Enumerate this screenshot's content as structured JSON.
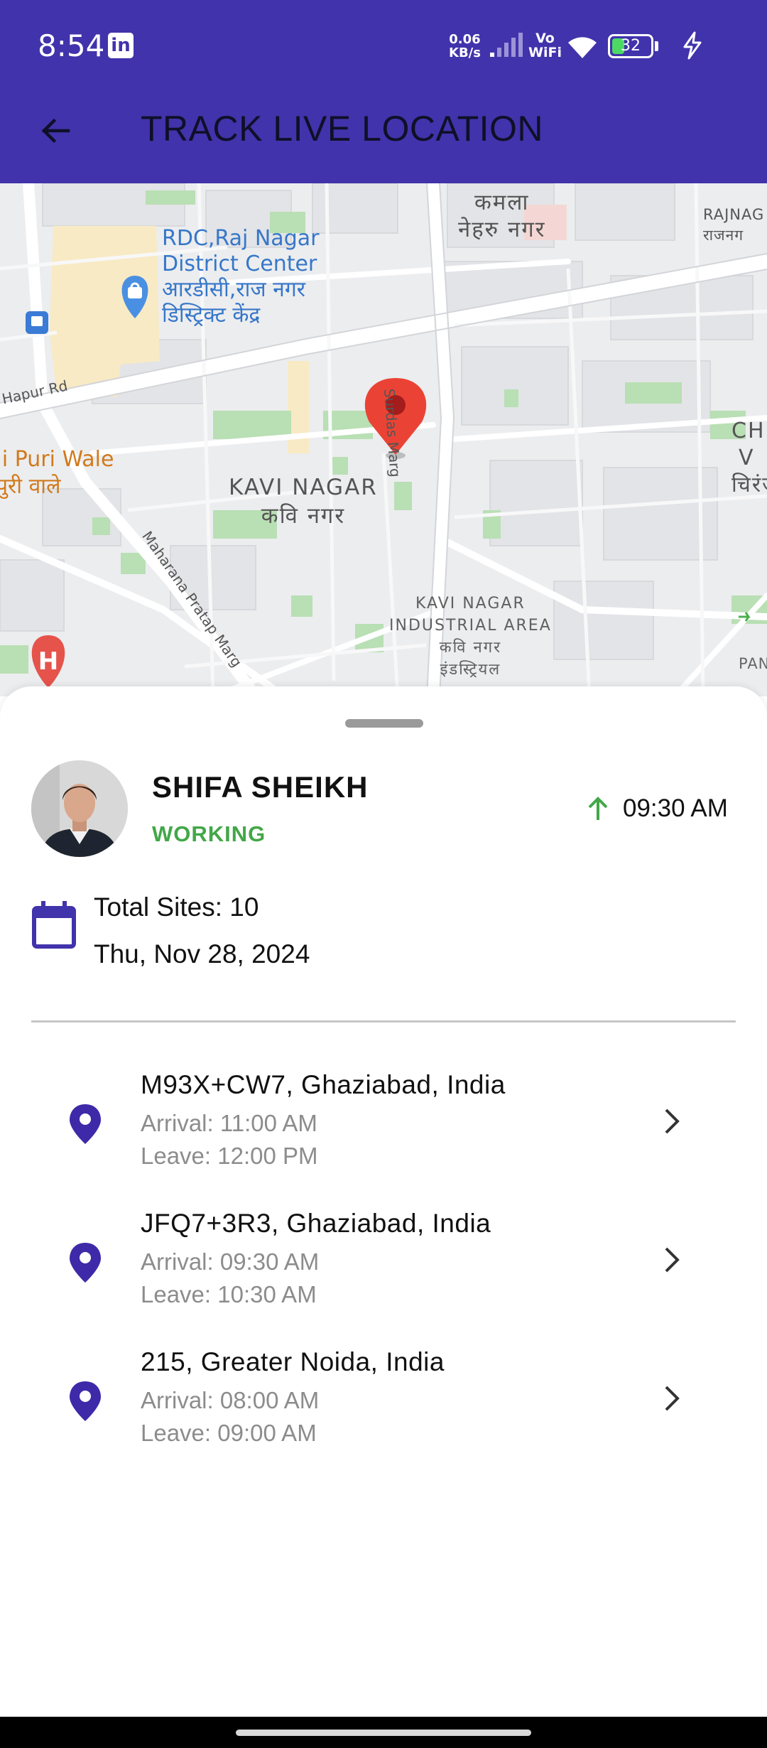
{
  "status_bar": {
    "time": "8:54",
    "app_notification_icon": "linkedin-icon",
    "net_speed_value": "0.06",
    "net_speed_unit": "KB/s",
    "vowifi_top": "Vo",
    "vowifi_bottom": "WiFi",
    "battery_level": "32",
    "battery_fraction": 0.32,
    "charging": true
  },
  "header": {
    "title": "TRACK LIVE LOCATION",
    "back_icon": "arrow-left-icon",
    "background_color": "#4133AB"
  },
  "map": {
    "labels": {
      "kamla_nehru_nagar_hi_1": "कमला",
      "kamla_nehru_nagar_hi_2": "नेहरु नगर",
      "rajnagar_en": "RAJNAG",
      "rajnagar_hi": "राजनग",
      "rdc_en_1": "RDC,Raj Nagar",
      "rdc_en_2": "District Center",
      "rdc_hi_1": "आरडीसी,राज नगर",
      "rdc_hi_2": "डिस्ट्रिक्ट केंद्र",
      "hapur_rd": "Hapur Rd",
      "surdas_marg": "Surdas Marg",
      "ji_puri_wale_en": "Ji Puri Wale",
      "ji_puri_wale_hi": "पुरी वाले",
      "kavi_nagar_en": "KAVI NAGAR",
      "kavi_nagar_hi": "कवि नगर",
      "maharana_pratap_marg": "Maharana Pratap Marg",
      "industrial_en_1": "KAVI NAGAR",
      "industrial_en_2": "INDUSTRIAL AREA",
      "industrial_hi_1": "कवि नगर",
      "industrial_hi_2": "इंडस्ट्रियल",
      "right_ch": "CH",
      "right_v": "V",
      "right_hi": "चिरंज",
      "right_pan": "PAN"
    }
  },
  "employee": {
    "name": "SHIFA SHEIKH",
    "status": "WORKING",
    "checkin_time": "09:30 AM",
    "status_color": "#43A748"
  },
  "summary": {
    "total_sites": "Total Sites: 10",
    "date": "Thu, Nov 28, 2024"
  },
  "visits": [
    {
      "address": "M93X+CW7, Ghaziabad, India",
      "arrival": "Arrival: 11:00 AM",
      "leave": "Leave: 12:00 PM"
    },
    {
      "address": "JFQ7+3R3, Ghaziabad, India",
      "arrival": "Arrival: 09:30 AM",
      "leave": "Leave: 10:30 AM"
    },
    {
      "address": "215, Greater Noida, India",
      "arrival": "Arrival: 08:00 AM",
      "leave": "Leave: 09:00 AM"
    }
  ],
  "colors": {
    "accent": "#4133AB",
    "pin": "#3E2AA8",
    "map_pin": "#E53935",
    "secondary_text": "#8C8C8C"
  }
}
